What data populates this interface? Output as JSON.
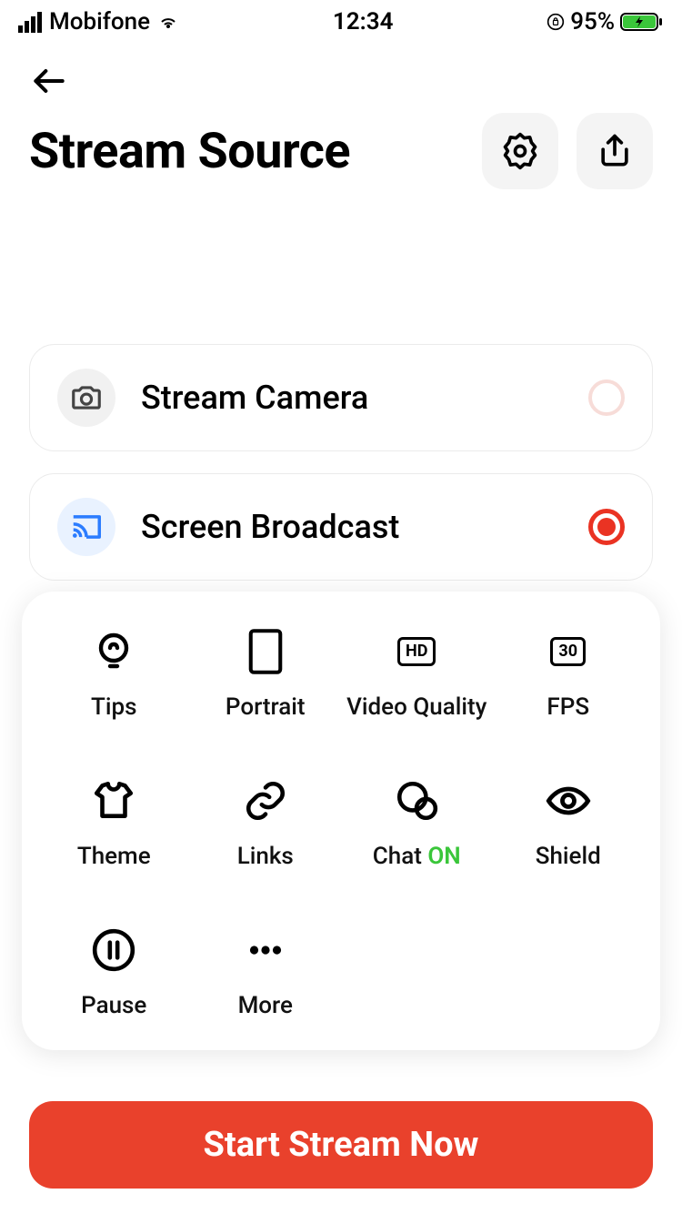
{
  "status": {
    "carrier": "Mobifone",
    "time": "12:34",
    "battery_pct": "95%"
  },
  "header": {
    "title": "Stream Source"
  },
  "sources": [
    {
      "label": "Stream Camera",
      "selected": false
    },
    {
      "label": "Screen Broadcast",
      "selected": true
    }
  ],
  "quick": {
    "tips": "Tips",
    "portrait": "Portrait",
    "video_quality": "Video Quality",
    "hd_badge": "HD",
    "fps": "FPS",
    "fps_badge": "30",
    "theme": "Theme",
    "links": "Links",
    "chat": "Chat",
    "chat_state": "ON",
    "shield": "Shield",
    "pause": "Pause",
    "more": "More"
  },
  "cta": "Start Stream Now"
}
